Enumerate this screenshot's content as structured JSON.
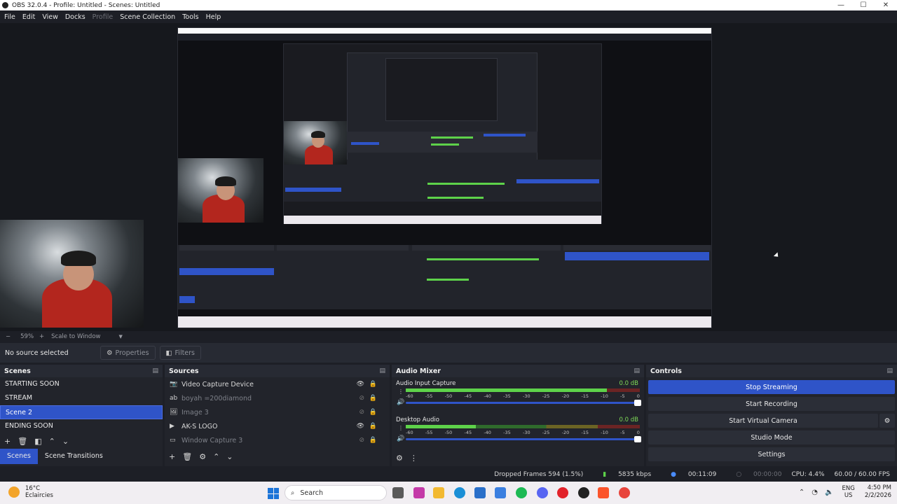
{
  "window": {
    "title": "OBS 32.0.4 - Profile: Untitled - Scenes: Untitled",
    "min": "—",
    "max": "☐",
    "close": "✕"
  },
  "menu": [
    "File",
    "Edit",
    "View",
    "Docks",
    "Profile",
    "Scene Collection",
    "Tools",
    "Help"
  ],
  "menu_disabled": "Profile",
  "zoom": {
    "minus": "−",
    "value": "59%",
    "plus": "+",
    "mode": "Scale to Window",
    "arrow": "▼"
  },
  "sourcebar": {
    "no_source": "No source selected",
    "properties": "Properties",
    "filters": "Filters"
  },
  "scenes": {
    "title": "Scenes",
    "items": [
      "STARTING SOON",
      "STREAM",
      "Scene 2",
      "ENDING SOON"
    ],
    "selected_index": 2,
    "tabs": [
      "Scenes",
      "Scene Transitions"
    ]
  },
  "sources": {
    "title": "Sources",
    "items": [
      {
        "name": "Video Capture Device",
        "icon": "camera-icon",
        "visible": true
      },
      {
        "name": "boyah =200diamond",
        "icon": "text-icon",
        "visible": false
      },
      {
        "name": "Image 3",
        "icon": "image-icon",
        "visible": false
      },
      {
        "name": "AK-S LOGO",
        "icon": "media-icon",
        "visible": true
      },
      {
        "name": "Window Capture 3",
        "icon": "window-icon",
        "visible": false
      }
    ]
  },
  "mixer": {
    "title": "Audio Mixer",
    "channels": [
      {
        "name": "Audio Input Capture",
        "db": "0.0 dB",
        "level": 0.86
      },
      {
        "name": "Desktop Audio",
        "db": "0.0 dB",
        "level": 0.3
      }
    ],
    "scale": [
      "-60",
      "-55",
      "-50",
      "-45",
      "-40",
      "-35",
      "-30",
      "-25",
      "-20",
      "-15",
      "-10",
      "-5",
      "0"
    ]
  },
  "controls": {
    "title": "Controls",
    "buttons": [
      "Stop Streaming",
      "Start Recording",
      "Start Virtual Camera",
      "Studio Mode",
      "Settings"
    ]
  },
  "status": {
    "dropped": "Dropped Frames 594 (1.5%)",
    "kbps": "5835 kbps",
    "stream_time": "00:11:09",
    "rec_time": "00:00:00",
    "cpu": "CPU: 4.4%",
    "fps": "60.00 / 60.00 FPS"
  },
  "taskbar": {
    "temp": "16°C",
    "weather": "Eclaircies",
    "search": "Search",
    "lang": "ENG",
    "region": "US",
    "time": "4:50 PM",
    "date": "2/2/2026"
  },
  "colors": {
    "accent": "#2f54c8",
    "meter_green": "#5ed24a",
    "dock_bg": "#22242b"
  }
}
